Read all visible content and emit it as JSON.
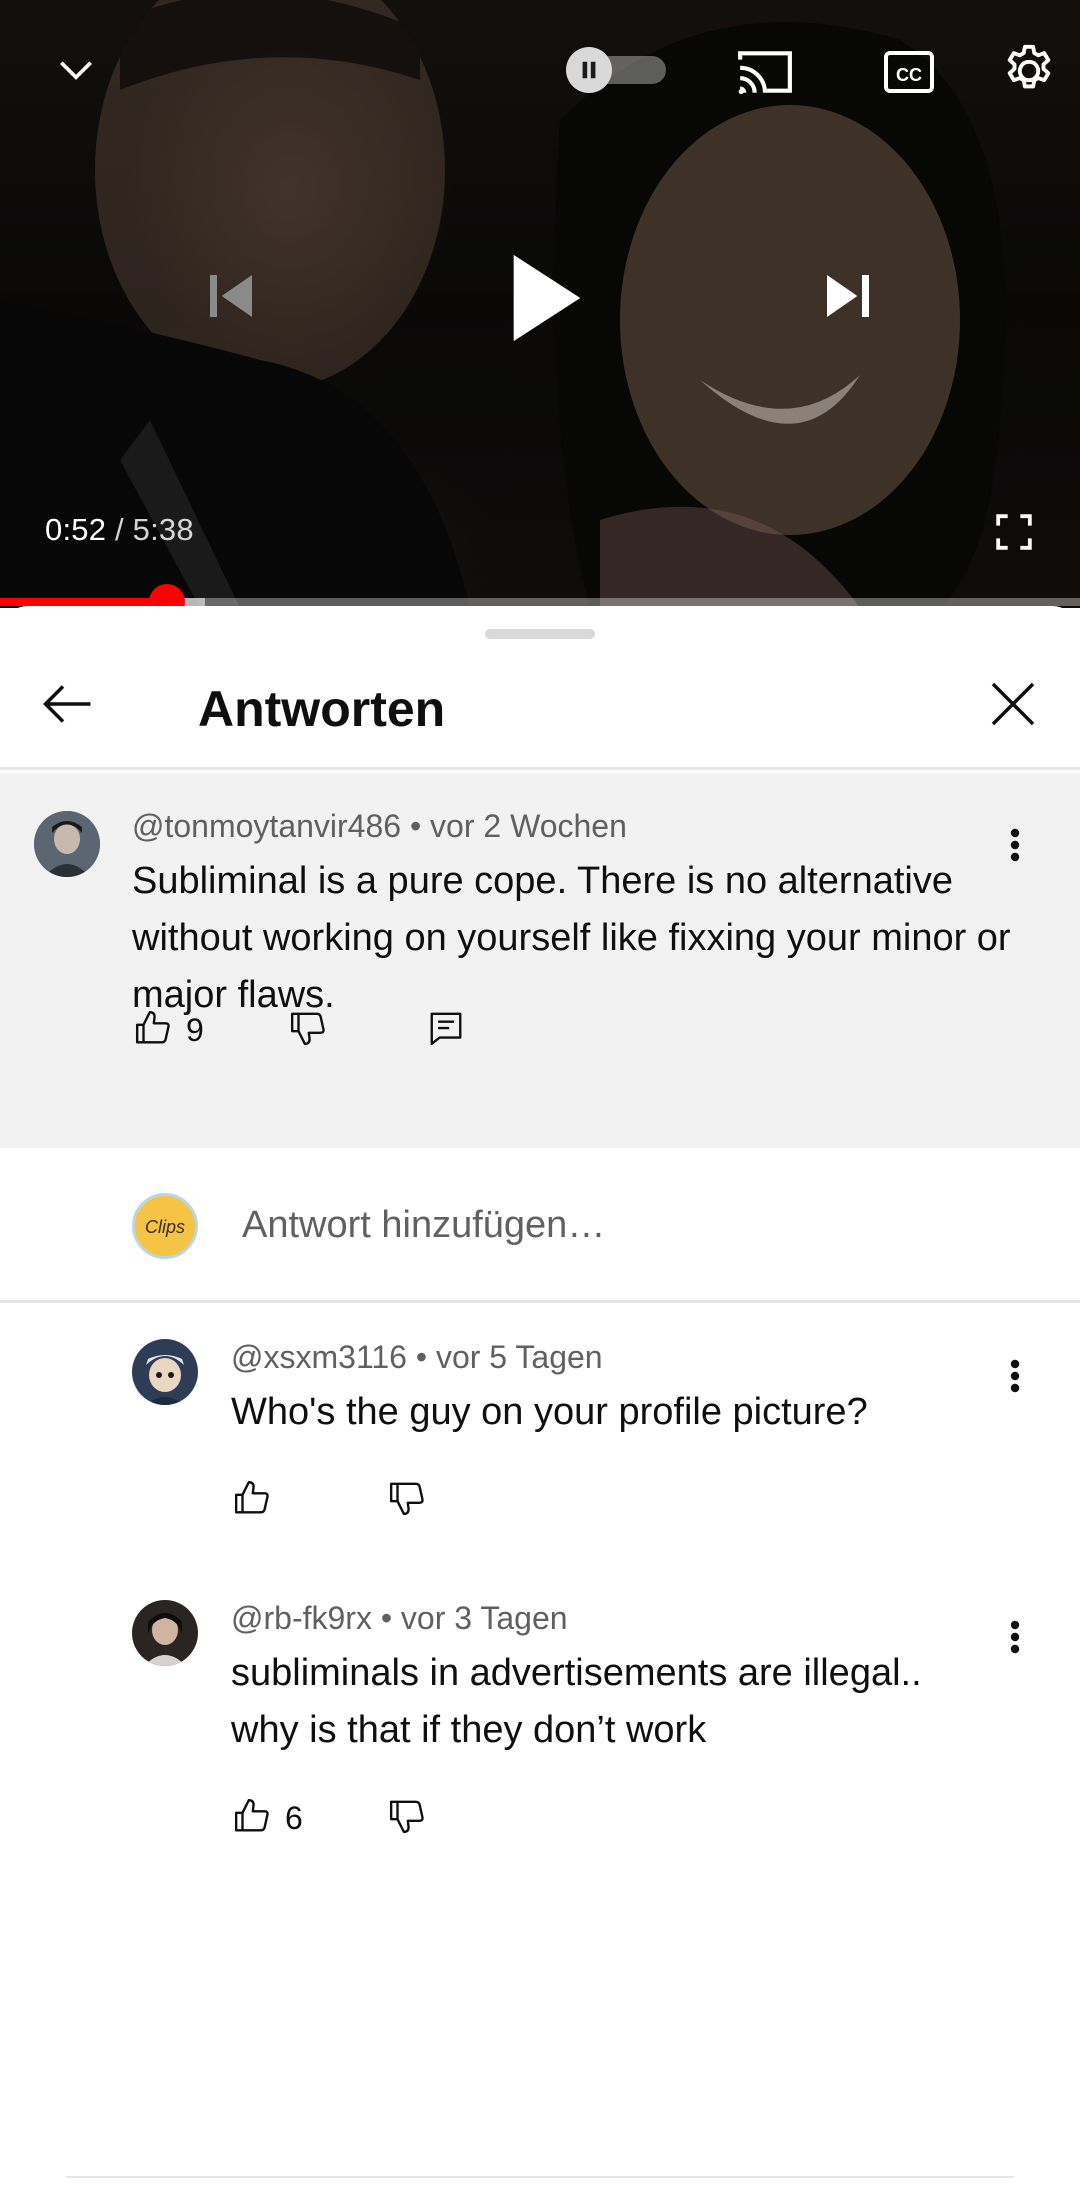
{
  "player": {
    "current_time": "0:52",
    "separator": "/",
    "duration": "5:38",
    "progress_fraction": 0.155,
    "buffered_fraction": 0.19,
    "accent_color": "#ff0000",
    "icons": [
      "chevron-down-icon",
      "autoplay-toggle-icon",
      "cast-icon",
      "closed-captions-icon",
      "settings-gear-icon",
      "previous-icon",
      "play-icon",
      "next-icon",
      "fullscreen-icon"
    ]
  },
  "sheet": {
    "title": "Antworten",
    "icons": [
      "back-arrow-icon",
      "close-icon"
    ]
  },
  "parent_comment": {
    "author": "@tonmoytanvir486",
    "time": " • vor 2 Wochen",
    "text": "Subliminal is a pure cope. There is no alternative without working on yourself like fixxing your minor or major flaws.",
    "likes": "9",
    "icons": [
      "like-icon",
      "dislike-icon",
      "reply-icon",
      "more-vert-icon"
    ]
  },
  "add_reply": {
    "placeholder": "Antwort hinzufügen…",
    "avatar_label": "Clips"
  },
  "replies": [
    {
      "author": "@xsxm3116",
      "time": " • vor 5 Tagen",
      "text": "Who's the guy on your profile picture?",
      "likes": ""
    },
    {
      "author": "@rb-fk9rx",
      "time": " • vor 3 Tagen",
      "text": "subliminals in advertisements are illegal.. why is that if they don’t work",
      "likes": "6"
    }
  ]
}
